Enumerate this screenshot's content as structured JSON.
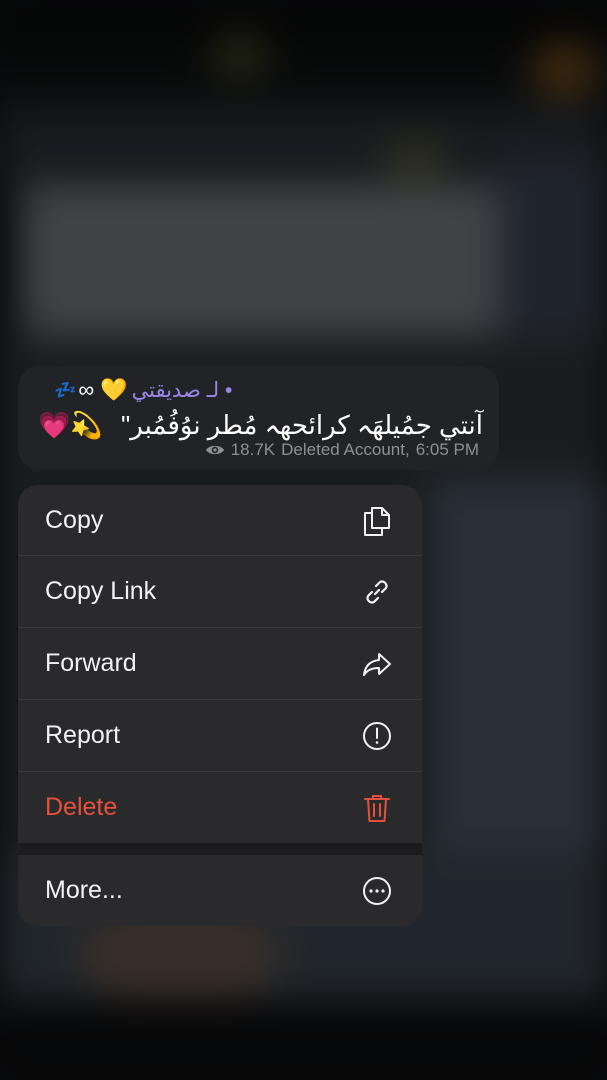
{
  "message": {
    "signature": "• لـ صديقتي",
    "signature_emojis": "∞ 💛",
    "signature_zzz": "💤",
    "text": "آنتي جمُيلهَہ كرائحهہ مُطر نوُفُمُبر\"",
    "text_emojis": "💗💫",
    "views": "18.7K",
    "author": "Deleted Account,",
    "time": "6:05 PM"
  },
  "menu": {
    "items": [
      {
        "label": "Copy",
        "icon": "copy-icon"
      },
      {
        "label": "Copy Link",
        "icon": "link-icon"
      },
      {
        "label": "Forward",
        "icon": "forward-icon"
      },
      {
        "label": "Report",
        "icon": "report-icon"
      },
      {
        "label": "Delete",
        "icon": "trash-icon"
      },
      {
        "label": "More...",
        "icon": "more-icon"
      }
    ]
  },
  "colors": {
    "menu_background": "#2a2a2c",
    "destructive": "#e5503d",
    "signature": "#9b86e8",
    "meta": "#8d8f94"
  }
}
